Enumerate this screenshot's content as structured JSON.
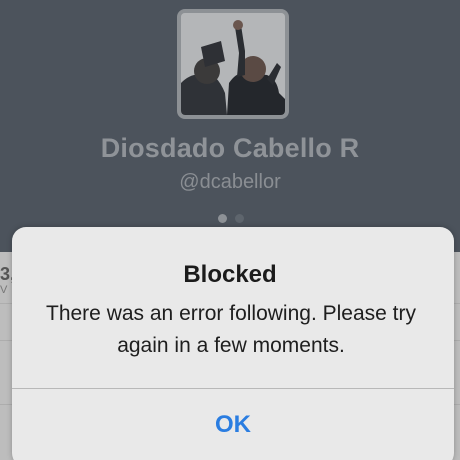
{
  "profile": {
    "name": "Diosdado Cabello R",
    "handle": "@dcabellor",
    "page_indicator": {
      "count": 2,
      "active_index": 0
    }
  },
  "background_list": {
    "row1_fragment": "3,",
    "row1_sub_fragment": "V"
  },
  "alert": {
    "title": "Blocked",
    "message": "There was an error following. Please try again in a few moments.",
    "button_label": "OK"
  },
  "colors": {
    "header_bg": "#4c535c",
    "alert_bg": "#e9e9e9",
    "ok_button": "#2a7de1"
  }
}
